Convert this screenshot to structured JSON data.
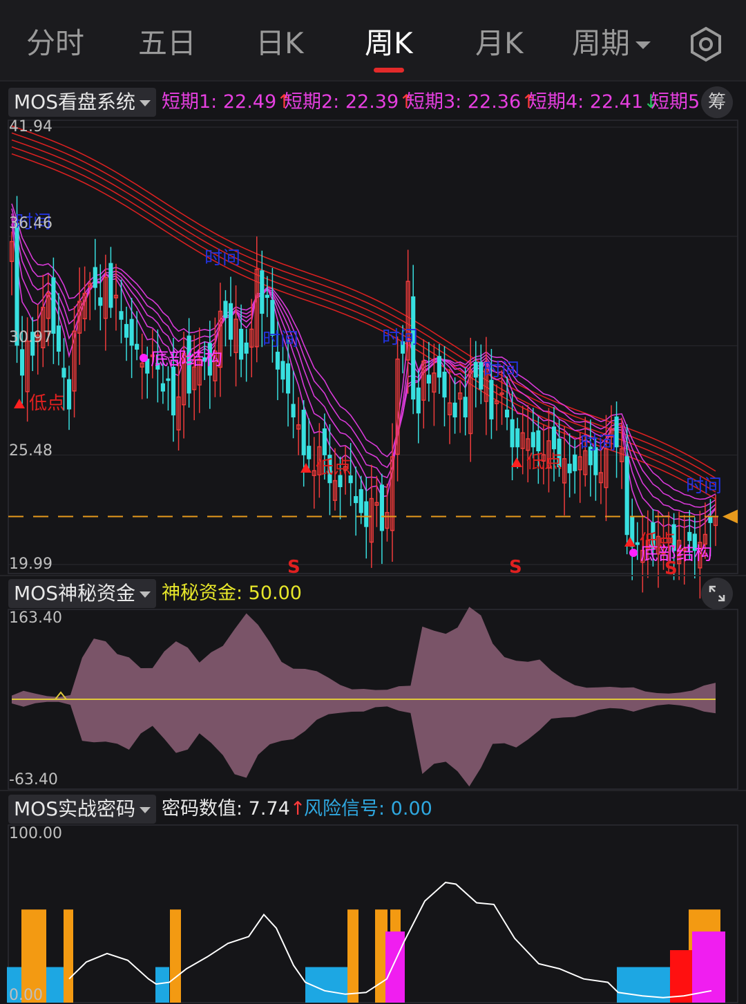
{
  "tabs": {
    "items": [
      {
        "label": "分时"
      },
      {
        "label": "五日"
      },
      {
        "label": "日K"
      },
      {
        "label": "周K"
      },
      {
        "label": "月K"
      },
      {
        "label": "周期"
      }
    ],
    "active": "周K",
    "settings_icon": "gear-icon",
    "underline_color": "#e32a2a"
  },
  "main_panel": {
    "selector_label": "MOS看盘系统",
    "values": [
      {
        "label": "短期1: 22.49",
        "arrow": "↑",
        "color": "#e63fe0",
        "arrow_color": "#ff3b3b"
      },
      {
        "label": "短期2: 22.39",
        "arrow": "↑",
        "color": "#e63fe0",
        "arrow_color": "#ff3b3b"
      },
      {
        "label": "短期3: 22.36",
        "arrow": "↑",
        "color": "#e63fe0",
        "arrow_color": "#ff3b3b"
      },
      {
        "label": "短期4: 22.41",
        "arrow": "↓",
        "color": "#e63fe0",
        "arrow_color": "#23c45e"
      },
      {
        "label": "短期5",
        "arrow": "",
        "color": "#e63fe0",
        "arrow_color": ""
      }
    ],
    "chip_button": "筹",
    "y_labels": [
      "41.94",
      "36.46",
      "30.97",
      "25.48",
      "19.99"
    ],
    "current_price_level": 22.4,
    "annotations": {
      "low": "低点",
      "bottom_structure": "底部结构",
      "time": "时间",
      "sell": "S"
    },
    "colors": {
      "up": "#ef3b3b",
      "down": "#38e0e0",
      "short_ma": "#d93ad9",
      "long_ma": "#d92020",
      "price_line": "#e79a1d"
    }
  },
  "chart_data": [
    {
      "type": "candlestick",
      "title": "MOS看盘系统",
      "ylim": [
        19.99,
        41.94
      ],
      "y_ticks": [
        41.94,
        36.46,
        30.97,
        25.48,
        19.99
      ],
      "series": [
        {
          "name": "短期1",
          "last": 22.49
        },
        {
          "name": "短期2",
          "last": 22.39
        },
        {
          "name": "短期3",
          "last": 22.36
        },
        {
          "name": "短期4",
          "last": 22.41
        }
      ],
      "closes": [
        36.2,
        31.0,
        29.5,
        31.2,
        30.5,
        31.5,
        32.9,
        33.6,
        31.6,
        30.7,
        29.4,
        27.8,
        31.7,
        33.2,
        33.6,
        34.1,
        33.9,
        33.0,
        34.4,
        32.9,
        33.5,
        32.3,
        31.4,
        31.0,
        30.8,
        30.1,
        29.6,
        30.5,
        29.8,
        28.7,
        29.3,
        27.5,
        28.4,
        30.6,
        28.6,
        29.9,
        30.3,
        30.2,
        29.5,
        30.7,
        32.7,
        32.4,
        31.3,
        32.3,
        30.3,
        30.6,
        31.8,
        34.8,
        32.6,
        33.4,
        31.5,
        29.8,
        29.3,
        28.6,
        27.4,
        27.0,
        25.5,
        25.3,
        24.7,
        25.9,
        25.5,
        24.1,
        24.2,
        23.9,
        24.9,
        24.1,
        23.1,
        22.6,
        21.9,
        23.3,
        23.1,
        21.7,
        22.6,
        25.4,
        30.3,
        30.6,
        34.2,
        28.3,
        27.6,
        30.2,
        29.1,
        29.6,
        29.4,
        28.4,
        28.1,
        27.4,
        28.6,
        27.4,
        29.7,
        29.4,
        28.8,
        29.8,
        27.3,
        28.2,
        28.6,
        27.4,
        25.9,
        25.9,
        26.6,
        26.3,
        25.9,
        25.7,
        25.5,
        26.2,
        25.8,
        24.9,
        25.3,
        24.6,
        24.7,
        25.4,
        25.7,
        25.0,
        24.5,
        24.6,
        25.8,
        26.8,
        25.9,
        25.8,
        21.5,
        20.9,
        21.0,
        20.7,
        21.2,
        20.8,
        21.4,
        20.6,
        21.3,
        20.7,
        21.2,
        20.8,
        21.2,
        20.7,
        21.1,
        21.5,
        22.1,
        22.4
      ],
      "markers": [
        "低点",
        "底部结构",
        "时间",
        "S"
      ]
    },
    {
      "type": "area",
      "title": "MOS神秘资金",
      "ylim": [
        -63.4,
        163.4
      ],
      "series": [
        {
          "name": "神秘资金",
          "last": 50.0
        }
      ]
    },
    {
      "type": "bar",
      "title": "MOS实战密码",
      "ylim": [
        0.0,
        100.0
      ],
      "series": [
        {
          "name": "密码数值",
          "last": 7.74
        },
        {
          "name": "风险信号",
          "last": 0.0
        }
      ]
    }
  ],
  "fund_panel": {
    "selector_label": "MOS神秘资金",
    "value_label": "神秘资金: 50.00",
    "value_color": "#e6e62a",
    "y_labels": [
      "163.40",
      "-63.40"
    ],
    "expand_icon": "expand-icon",
    "area_color": "#7a5468",
    "line_color": "#e0c93a"
  },
  "code_panel": {
    "selector_label": "MOS实战密码",
    "value1_label": "密码数值: 7.74",
    "value1_arrow": "↑",
    "value2_label": "风险信号: 0.00",
    "value2_color": "#2fa8e0",
    "y_labels": [
      "100.00",
      "0.00"
    ],
    "colors": {
      "orange": "#f39a12",
      "blue": "#1da7e3",
      "magenta": "#f01ef0",
      "red": "#ff1010",
      "line": "#ffffff"
    }
  }
}
